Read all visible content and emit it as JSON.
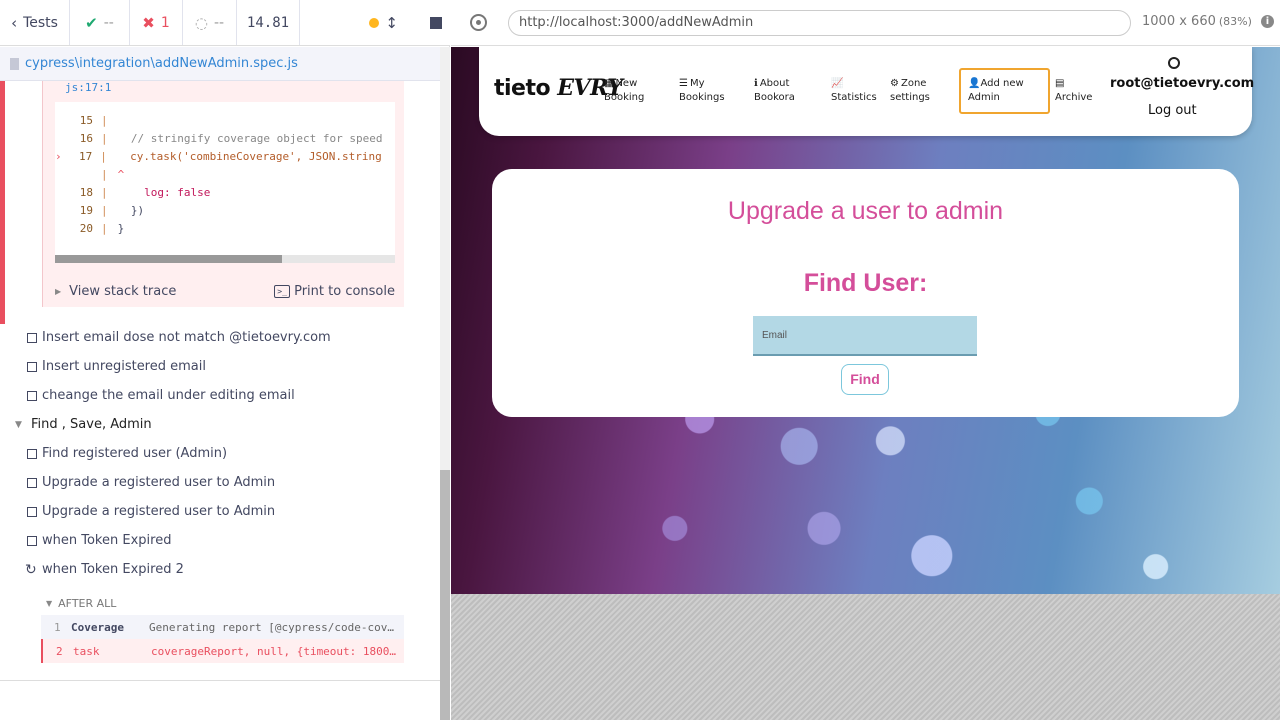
{
  "reporter": {
    "tests_label": "Tests",
    "passed": "--",
    "failed": "1",
    "pending": "--",
    "duration": "14.81",
    "spec_path": "cypress\\integration\\addNewAdmin.spec.js",
    "error": {
      "file_ref": "js:17:1",
      "code_lines": [
        {
          "num": "15",
          "text": ""
        },
        {
          "num": "16",
          "text": "  // stringify coverage object for speed"
        },
        {
          "num": "17",
          "text": "  cy.task('combineCoverage', JSON.string"
        },
        {
          "num": "",
          "text": "^"
        },
        {
          "num": "18",
          "text": "    log: false"
        },
        {
          "num": "19",
          "text": "  })"
        },
        {
          "num": "20",
          "text": "}"
        }
      ],
      "view_stack_trace": "View stack trace",
      "print_to_console": "Print to console",
      "terminal_glyph": ">_"
    },
    "tests": [
      "Insert email dose not match @tietoevry.com",
      "Insert unregistered email",
      "cheange the email under editing email"
    ],
    "suite": "Find , Save, Admin",
    "suite_tests": [
      "Find registered user (Admin)",
      "Upgrade a registered user to Admin",
      "Upgrade a registered user to Admin",
      "when Token Expired",
      "when Token Expired 2"
    ],
    "after_all_label": "AFTER ALL",
    "commands": [
      {
        "n": "1",
        "name": "Coverage",
        "msg": "Generating report [@cypress/code-cov…"
      },
      {
        "n": "2",
        "name": "task",
        "msg": "coverageReport, null, {timeout: 1800…"
      }
    ]
  },
  "aut": {
    "url": "http://localhost:3000/addNewAdmin",
    "viewport": "1000 x 660",
    "scale": "(83%)",
    "info_glyph": "i",
    "app": {
      "logo_main": "tieto",
      "logo_accent": "EVRY",
      "nav": [
        {
          "line1": "New",
          "line2": "Booking",
          "icon": "calendar-icon"
        },
        {
          "line1": "My",
          "line2": "Bookings",
          "icon": "list-icon"
        },
        {
          "line1": "About",
          "line2": "Bookora",
          "icon": "info-icon"
        },
        {
          "line1": "",
          "line2": "Statistics",
          "icon": "chart-icon"
        },
        {
          "line1": "Zone",
          "line2": "settings",
          "icon": "gear-icon"
        }
      ],
      "nav_add": {
        "line1": "Add new",
        "line2": "Admin",
        "icon": "user-plus-icon"
      },
      "nav_archive": {
        "line1": "",
        "line2": "Archive",
        "icon": "table-icon"
      },
      "user_email": "root@tietoevry.com",
      "logout": "Log out",
      "card_title": "Upgrade a user to admin",
      "find_label": "Find User:",
      "email_placeholder": "Email",
      "find_button": "Find"
    }
  }
}
